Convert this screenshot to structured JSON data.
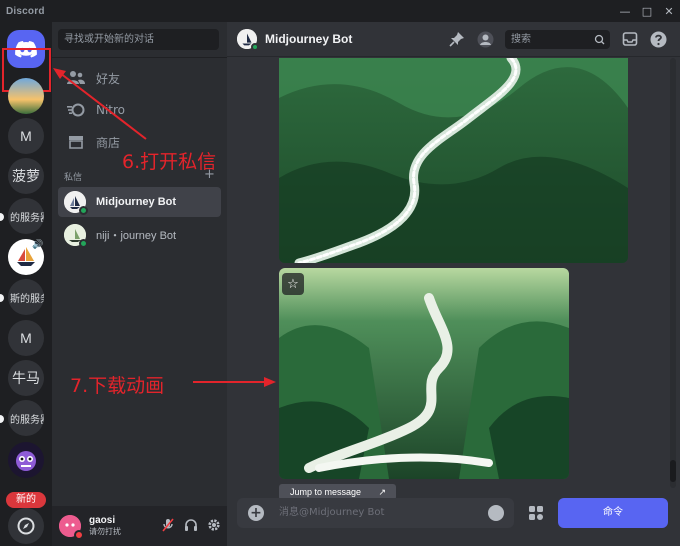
{
  "window": {
    "app_name": "Discord",
    "minimize": "—",
    "maximize": "□",
    "close": "✕"
  },
  "servers": {
    "items": [
      {
        "label": "M"
      },
      {
        "label": "菠萝"
      },
      {
        "label": "的服务器"
      },
      {
        "label": "斯的服务"
      },
      {
        "label": "M"
      },
      {
        "label": "牛马"
      },
      {
        "label": "的服务器"
      }
    ],
    "new_badge": "新的"
  },
  "dm_panel": {
    "search_placeholder": "寻找或开始新的对话",
    "nav": {
      "friends": "好友",
      "nitro": "Nitro",
      "shop": "商店"
    },
    "section_title": "私信",
    "section_add": "+",
    "dms": [
      {
        "name": "Midjourney Bot",
        "active": true
      },
      {
        "name": "niji・journey Bot",
        "active": false
      }
    ]
  },
  "user_panel": {
    "username": "gaosi",
    "status": "请勿打扰"
  },
  "chat": {
    "title": "Midjourney Bot",
    "search_placeholder": "搜索",
    "jump_label": "Jump to message",
    "composer_placeholder": "消息@Midjourney Bot",
    "command_button": "命令"
  },
  "annotations": {
    "step6": "6.打开私信",
    "step7": "7.下载动画",
    "color": "#e3242b"
  },
  "colors": {
    "accent": "#5865f2",
    "online": "#23a55a",
    "dnd": "#f23f43"
  }
}
